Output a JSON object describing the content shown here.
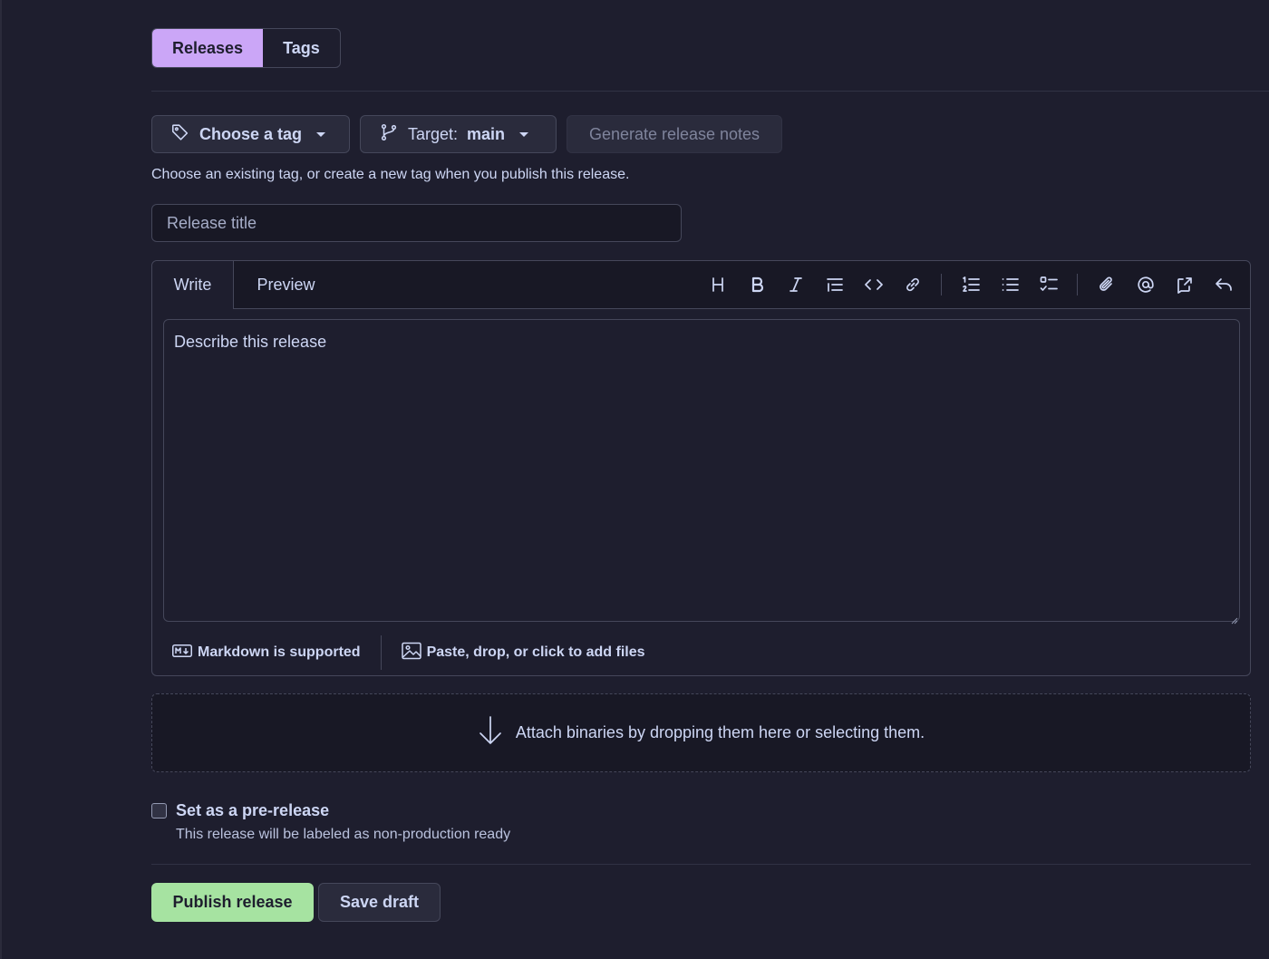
{
  "tabs": {
    "releases": "Releases",
    "tags": "Tags"
  },
  "tag_row": {
    "choose_tag": "Choose a tag",
    "target_label": "Target:",
    "target_value": "main",
    "generate_notes": "Generate release notes",
    "hint": "Choose an existing tag, or create a new tag when you publish this release."
  },
  "title_input": {
    "placeholder": "Release title",
    "value": ""
  },
  "editor": {
    "write_tab": "Write",
    "preview_tab": "Preview",
    "toolbar_icons": [
      "heading-icon",
      "bold-icon",
      "italic-icon",
      "quote-icon",
      "code-icon",
      "link-icon",
      "numbered-list-icon",
      "unordered-list-icon",
      "task-list-icon",
      "attach-icon",
      "mention-icon",
      "reference-icon",
      "undo-icon"
    ],
    "body_placeholder": "Describe this release",
    "markdown_note": "Markdown is supported",
    "files_note": "Paste, drop, or click to add files"
  },
  "dropzone": {
    "text": "Attach binaries by dropping them here or selecting them."
  },
  "prerelease": {
    "label": "Set as a pre-release",
    "description": "This release will be labeled as non-production ready",
    "checked": false
  },
  "actions": {
    "publish": "Publish release",
    "save_draft": "Save draft"
  },
  "colors": {
    "background": "#1e1e2e",
    "accent": "#cba6f7",
    "publish": "#a6e3a1",
    "text": "#cdd6f4"
  }
}
